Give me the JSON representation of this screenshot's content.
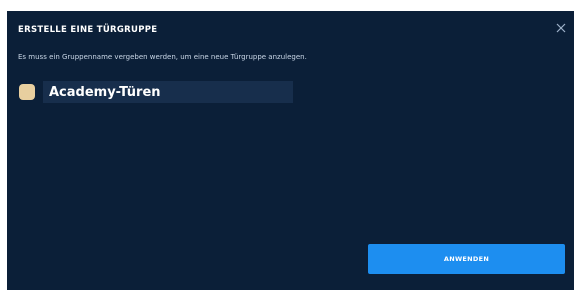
{
  "dialog": {
    "title": "ERSTELLE EINE TÜRGRUPPE",
    "close_icon": "close-icon",
    "description": "Es muss ein Gruppenname vergeben werden, um eine neue Türgruppe anzulegen.",
    "group": {
      "color": "#e8cf9f",
      "name_value": "Academy-Türen"
    },
    "apply_label": "ANWENDEN"
  },
  "colors": {
    "background": "#0b1f38",
    "input_background": "#172e4c",
    "accent": "#1d8ef0"
  }
}
